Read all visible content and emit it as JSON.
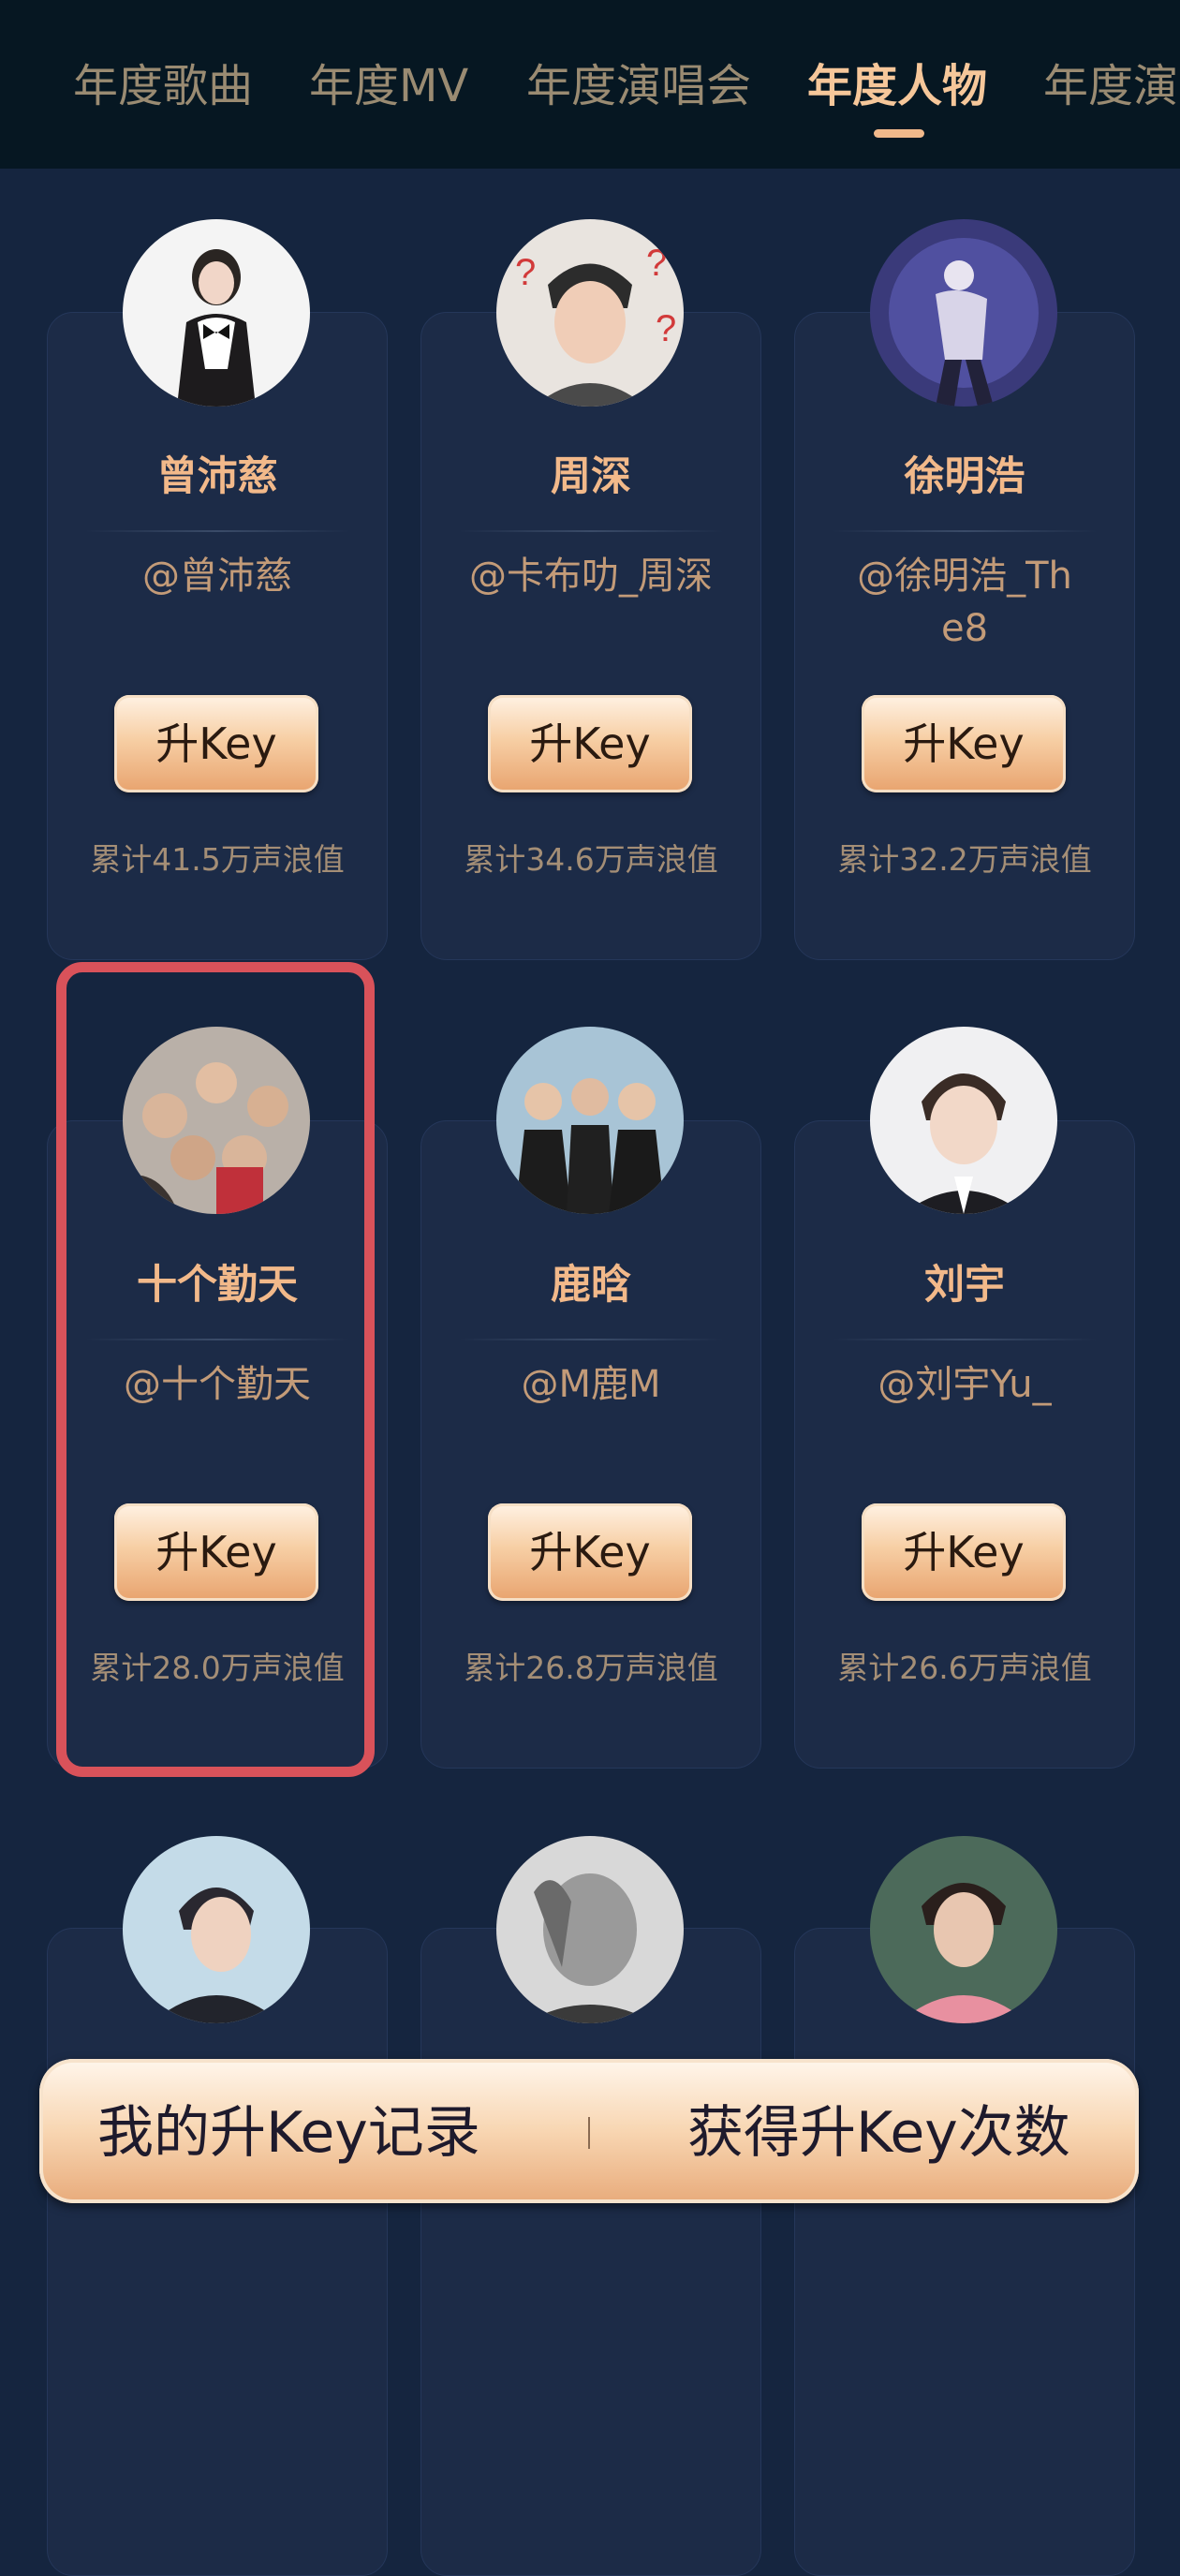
{
  "tabs": [
    {
      "label": "年度歌曲",
      "active": false
    },
    {
      "label": "年度MV",
      "active": false
    },
    {
      "label": "年度演唱会",
      "active": false
    },
    {
      "label": "年度人物",
      "active": true
    },
    {
      "label": "年度演",
      "active": false
    }
  ],
  "cards": [
    {
      "name": "曾沛慈",
      "handle": "@曾沛慈",
      "button": "升Key",
      "score": "累计41.5万声浪值"
    },
    {
      "name": "周深",
      "handle": "@卡布叻_周深",
      "button": "升Key",
      "score": "累计34.6万声浪值"
    },
    {
      "name": "徐明浩",
      "handle": "@徐明浩_The8",
      "button": "升Key",
      "score": "累计32.2万声浪值"
    },
    {
      "name": "十个勤天",
      "handle": "@十个勤天",
      "button": "升Key",
      "score": "累计28.0万声浪值"
    },
    {
      "name": "鹿晗",
      "handle": "@M鹿M",
      "button": "升Key",
      "score": "累计26.8万声浪值"
    },
    {
      "name": "刘宇",
      "handle": "@刘宇Yu_",
      "button": "升Key",
      "score": "累计26.6万声浪值"
    }
  ],
  "bottom_bar": {
    "left_label": "我的升Key记录",
    "right_label": "获得升Key次数"
  },
  "colors": {
    "accent": "#f2b98a",
    "highlight": "#d9525a",
    "background": "#15253f"
  }
}
